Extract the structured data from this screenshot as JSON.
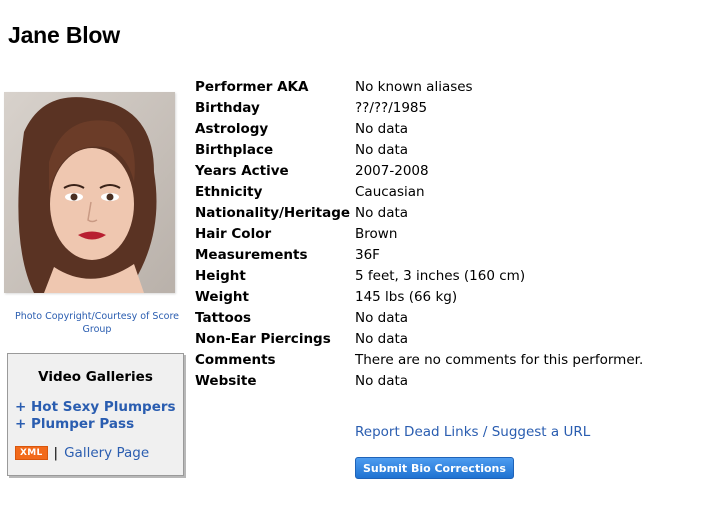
{
  "performer": {
    "name": "Jane Blow"
  },
  "photo": {
    "credit": "Photo Copyright/Courtesy of Score Group"
  },
  "galleries": {
    "title": "Video Galleries",
    "links": [
      "+ Hot Sexy Plumpers",
      "+ Plumper Pass"
    ],
    "xml_badge": "XML",
    "separator": "|",
    "gallery_page": "Gallery Page",
    "badge_color": "#f26a1b"
  },
  "bio": {
    "rows": [
      {
        "label": "Performer AKA",
        "value": "No known aliases"
      },
      {
        "label": "Birthday",
        "value": "??/??/1985"
      },
      {
        "label": "Astrology",
        "value": "No data"
      },
      {
        "label": "Birthplace",
        "value": "No data"
      },
      {
        "label": "Years Active",
        "value": "2007-2008"
      },
      {
        "label": "Ethnicity",
        "value": "Caucasian"
      },
      {
        "label": "Nationality/Heritage",
        "value": "No data"
      },
      {
        "label": "Hair Color",
        "value": "Brown"
      },
      {
        "label": "Measurements",
        "value": "36F"
      },
      {
        "label": "Height",
        "value": "5 feet, 3 inches (160 cm)"
      },
      {
        "label": "Weight",
        "value": "145 lbs (66 kg)"
      },
      {
        "label": "Tattoos",
        "value": "No data"
      },
      {
        "label": "Non-Ear Piercings",
        "value": "No data"
      },
      {
        "label": "Comments",
        "value": "There are no comments for this performer."
      },
      {
        "label": "Website",
        "value": "No data"
      }
    ]
  },
  "actions": {
    "report_link": "Report Dead Links / Suggest a URL",
    "submit_button": "Submit Bio Corrections"
  },
  "colors": {
    "link": "#2a5db0",
    "button": "#1f72d1"
  }
}
